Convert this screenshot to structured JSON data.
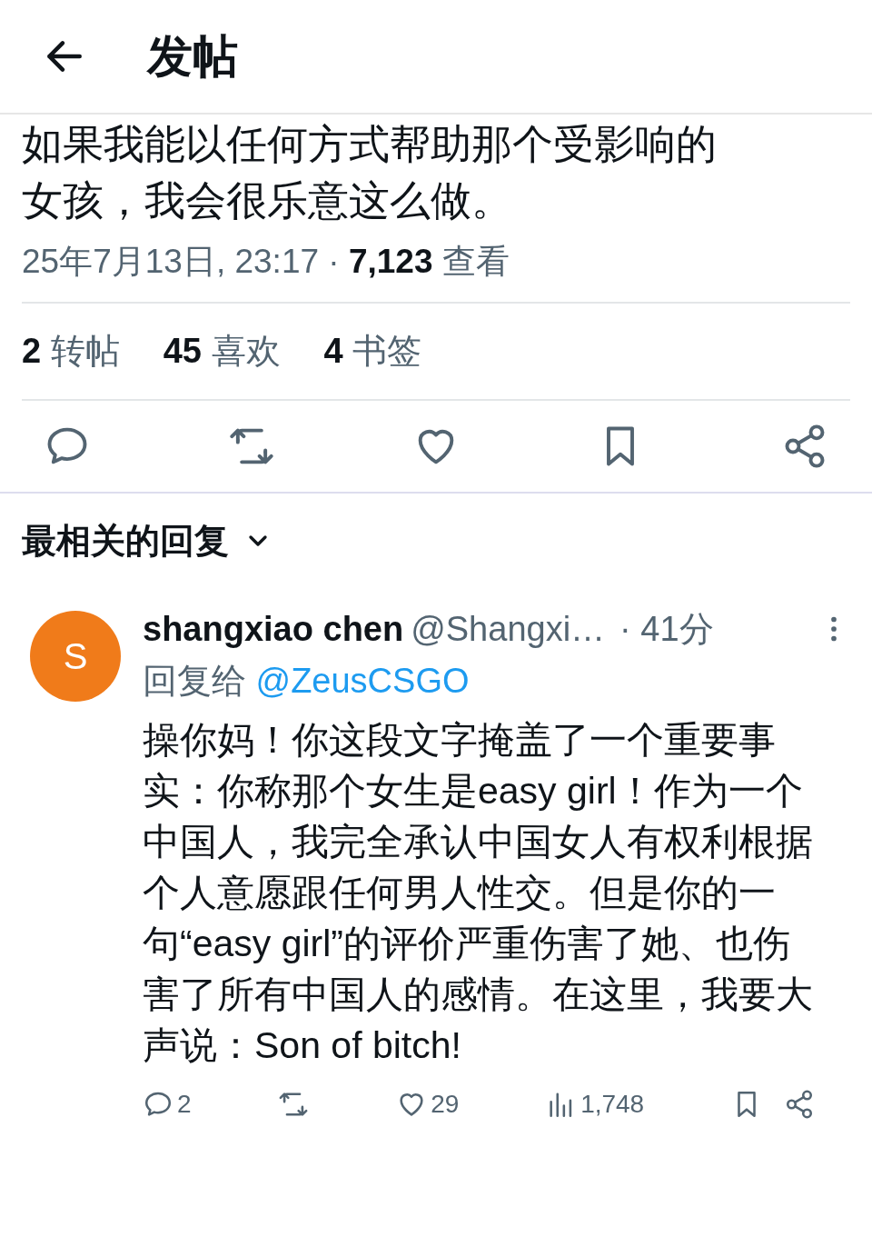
{
  "header": {
    "title": "发帖"
  },
  "post": {
    "text": "如果我能以任何方式帮助那个受影响的女孩，我会很乐意这么做。",
    "timestamp": "25年7月13日, 23:17",
    "separator": "·",
    "views_count": "7,123",
    "views_label": "查看",
    "stats": [
      {
        "count": "2",
        "label": "转帖"
      },
      {
        "count": "45",
        "label": "喜欢"
      },
      {
        "count": "4",
        "label": "书签"
      }
    ]
  },
  "replies_sort": {
    "label": "最相关的回复"
  },
  "reply": {
    "avatar_letter": "S",
    "name": "shangxiao chen",
    "handle": "@Shangxi…",
    "time": "· 41分",
    "reply_to_label": "回复给",
    "reply_to": "@ZeusCSGO",
    "text": "操你妈！你这段文字掩盖了一个重要事实：你称那个女生是easy girl！作为一个中国人，我完全承认中国女人有权利根据个人意愿跟任何男人性交。但是你的一句“easy girl”的评价严重伤害了她、也伤害了所有中国人的感情。在这里，我要大声说：Son of bitch!",
    "reply_count": "2",
    "like_count": "29",
    "view_count": "1,748"
  }
}
